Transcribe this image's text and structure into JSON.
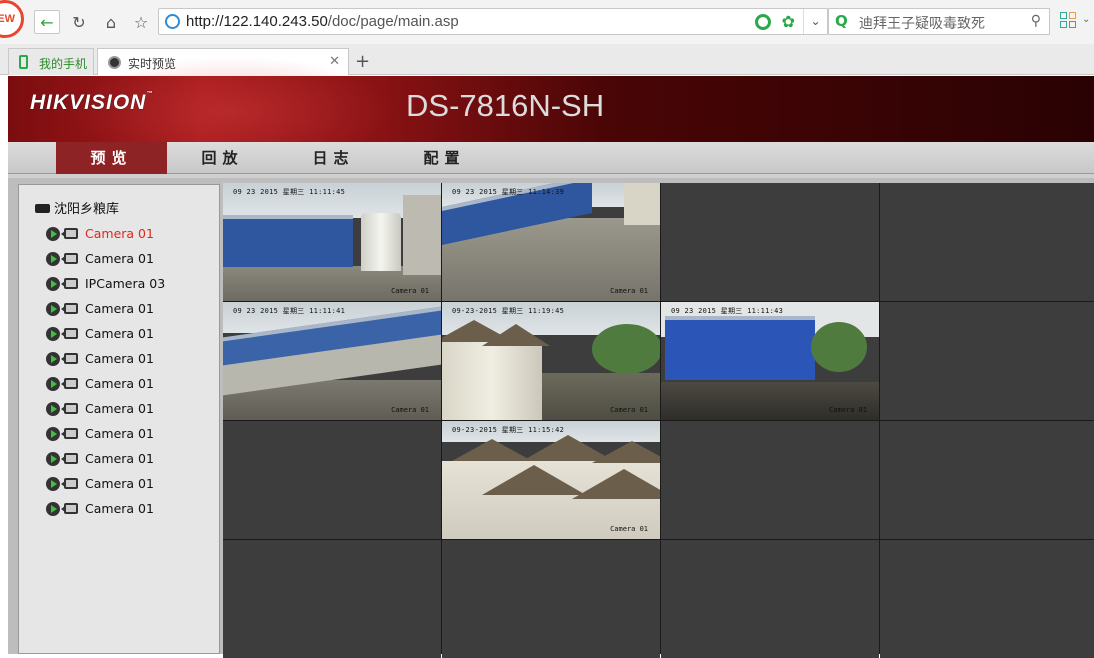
{
  "browser": {
    "new_badge": "EW",
    "address": {
      "scheme_host": "http://122.140.243.50",
      "path": "/doc/page/main.asp"
    },
    "search": {
      "text": "迪拜王子疑吸毒致死"
    },
    "tabs": [
      {
        "label": "我的手机",
        "icon": "phone-icon"
      },
      {
        "label": "实时预览",
        "icon": "camera-favicon",
        "active": true
      }
    ]
  },
  "app": {
    "brand": "HIKVISION",
    "trademark": "™",
    "model": "DS-7816N-SH",
    "menu": [
      {
        "label": "预览",
        "active": true
      },
      {
        "label": "回放"
      },
      {
        "label": "日志"
      },
      {
        "label": "配置"
      }
    ],
    "tree": {
      "root": "沈阳乡粮库",
      "cameras": [
        {
          "label": "Camera 01",
          "selected": true
        },
        {
          "label": "Camera 01"
        },
        {
          "label": "IPCamera 03"
        },
        {
          "label": "Camera 01"
        },
        {
          "label": "Camera 01"
        },
        {
          "label": "Camera 01"
        },
        {
          "label": "Camera 01"
        },
        {
          "label": "Camera 01"
        },
        {
          "label": "Camera 01"
        },
        {
          "label": "Camera 01"
        },
        {
          "label": "Camera 01"
        },
        {
          "label": "Camera 01"
        }
      ]
    },
    "grid": {
      "feeds": [
        {
          "time": "09 23 2015 星期三 11:11:45",
          "name": "Camera 01",
          "scene": "warehouse-tank",
          "selected": true
        },
        {
          "time": "09 23 2015 星期三 11:14:39",
          "name": "Camera 01",
          "scene": "yard"
        },
        null,
        null,
        {
          "time": "09 23 2015 星期三 11:11:41",
          "name": "Camera 01",
          "scene": "long-warehouse"
        },
        {
          "time": "09-23-2015 星期三 11:19:45",
          "name": "Camera 01",
          "scene": "silos-path"
        },
        {
          "time": "09 23 2015 星期三 11:11:43",
          "name": "Camera 01",
          "scene": "blue-warehouse"
        },
        null,
        null,
        {
          "time": "09-23-2015 星期三 11:15:42",
          "name": "Camera 01",
          "scene": "silos"
        },
        null,
        null,
        null,
        null,
        null,
        null
      ]
    }
  }
}
